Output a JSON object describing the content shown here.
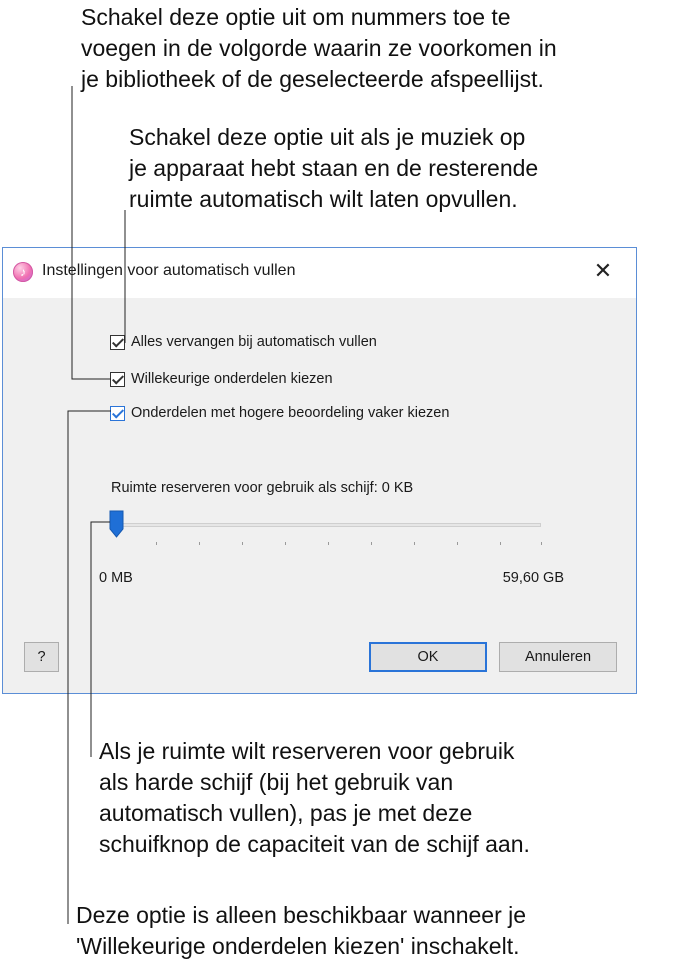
{
  "callouts": {
    "shuffle": [
      "Schakel deze optie uit om nummers toe te",
      "voegen in de volgorde waarin ze voorkomen in",
      "je bibliotheek of de geselecteerde afspeellijst."
    ],
    "replace": [
      "Schakel deze optie uit als je muziek op",
      "je apparaat hebt staan en de resterende",
      "ruimte automatisch wilt laten opvullen."
    ],
    "disk": [
      "Als je ruimte wilt reserveren voor gebruik",
      "als harde schijf (bij het gebruik van",
      "automatisch vullen), pas je met deze",
      "schuifknop de capaciteit van de schijf aan."
    ],
    "weight": [
      "Deze optie is alleen beschikbaar wanneer je",
      "'Willekeurige onderdelen kiezen' inschakelt."
    ]
  },
  "dialog": {
    "title": "Instellingen voor automatisch vullen",
    "app_icon": "itunes-note-icon",
    "close_glyph": "✕",
    "options": {
      "replace": {
        "label": "Alles vervangen bij automatisch vullen",
        "checked": true
      },
      "shuffle": {
        "label": "Willekeurige onderdelen kiezen",
        "checked": true
      },
      "weight": {
        "label": "Onderdelen met hogere beoordeling vaker kiezen",
        "checked": true
      }
    },
    "reserve_label": "Ruimte reserveren voor gebruik als schijf: 0 KB",
    "slider": {
      "min_label": "0 MB",
      "max_label": "59,60 GB",
      "value_fraction": 0.0
    },
    "buttons": {
      "help": "?",
      "ok": "OK",
      "cancel": "Annuleren"
    },
    "accent_color": "#2a74d8"
  }
}
